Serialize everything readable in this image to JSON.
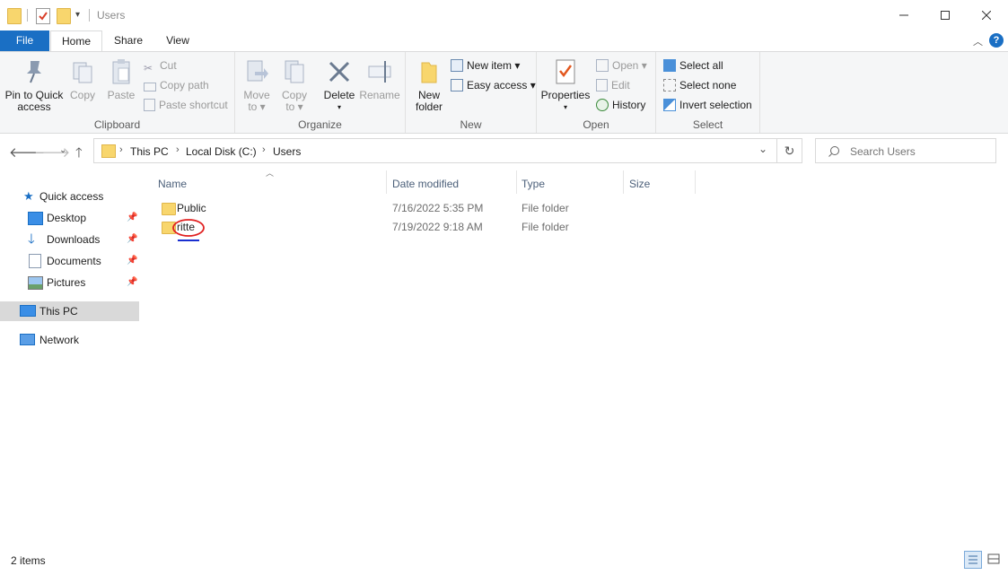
{
  "window": {
    "title": "Users",
    "minimize_icon": "minimize-icon",
    "maximize_icon": "maximize-icon",
    "close_icon": "close-icon"
  },
  "tabs": [
    {
      "label": "File"
    },
    {
      "label": "Home"
    },
    {
      "label": "Share"
    },
    {
      "label": "View"
    }
  ],
  "ribbon": {
    "clipboard": {
      "label": "Clipboard",
      "pin_line1": "Pin to Quick",
      "pin_line2": "access",
      "copy": "Copy",
      "paste": "Paste",
      "cut": "Cut",
      "copy_path": "Copy path",
      "paste_shortcut": "Paste shortcut"
    },
    "organize": {
      "label": "Organize",
      "move_line1": "Move",
      "move_line2": "to",
      "copy_line1": "Copy",
      "copy_line2": "to",
      "delete": "Delete",
      "rename": "Rename"
    },
    "new": {
      "label": "New",
      "new_folder_line1": "New",
      "new_folder_line2": "folder",
      "new_item": "New item",
      "easy_access": "Easy access"
    },
    "open": {
      "label": "Open",
      "properties": "Properties",
      "open": "Open",
      "edit": "Edit",
      "history": "History"
    },
    "select": {
      "label": "Select",
      "select_all": "Select all",
      "select_none": "Select none",
      "invert_selection": "Invert selection"
    }
  },
  "breadcrumb": [
    "This PC",
    "Local Disk (C:)",
    "Users"
  ],
  "search": {
    "placeholder": "Search Users"
  },
  "nav_pane": {
    "quick_access": "Quick access",
    "desktop": "Desktop",
    "downloads": "Downloads",
    "documents": "Documents",
    "pictures": "Pictures",
    "this_pc": "This PC",
    "network": "Network"
  },
  "columns": {
    "name": "Name",
    "date": "Date modified",
    "type": "Type",
    "size": "Size"
  },
  "files": [
    {
      "name": "Public",
      "date": "7/16/2022 5:35 PM",
      "type": "File folder"
    },
    {
      "name": "ritte",
      "date": "7/19/2022 9:18 AM",
      "type": "File folder"
    }
  ],
  "status": {
    "items": "2 items"
  },
  "colors": {
    "accent": "#1a6fc4",
    "annotation": "#e02020"
  }
}
